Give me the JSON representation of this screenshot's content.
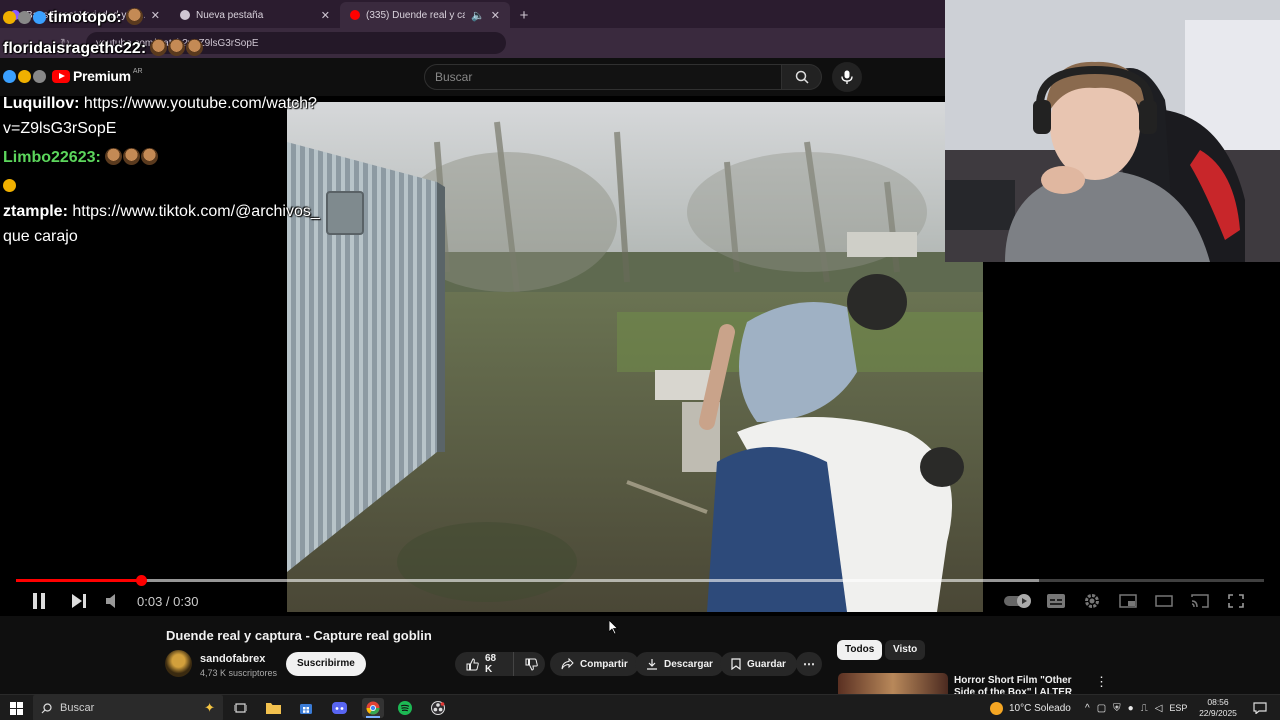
{
  "browser": {
    "tabs": [
      {
        "label": "Bass Boost Variedad y Cli...",
        "active": false
      },
      {
        "label": "Nueva pestaña",
        "active": false
      },
      {
        "label": "(335) Duende real y captura",
        "active": true
      }
    ],
    "url": "youtube.com/watch?v=Z9lsG3rSopE"
  },
  "youtube": {
    "logo_text": "Premium",
    "region": "AR",
    "search_placeholder": "Buscar"
  },
  "player": {
    "current_time": "0:03",
    "separator": " / ",
    "duration": "0:30",
    "progress_fraction": 0.1,
    "buffer_fraction": 0.82
  },
  "chat": [
    {
      "user": "timotopo:",
      "text": "",
      "user_color": "#ffffff"
    },
    {
      "user": "floridaisragethc22:",
      "text": "",
      "user_color": "#ffffff"
    },
    {
      "user": "Luquillov:",
      "text": " https://www.youtube.com/watch?",
      "user_color": "#ffffff"
    },
    {
      "user": "",
      "text": "v=Z9lsG3rSopE",
      "user_color": "#ffffff"
    },
    {
      "user": "Limbo22623:",
      "text": "",
      "user_color": "#5cd65c"
    },
    {
      "user": "ztample:",
      "text": " https://www.tiktok.com/@archivos_",
      "user_color": "#ffffff"
    },
    {
      "user": "",
      "text": "que carajo",
      "user_color": "#ffffff"
    }
  ],
  "video": {
    "title": "Duende real y captura - Capture real goblin",
    "channel": "sandofabrex",
    "subscribers": "4,73 K suscriptores",
    "subscribe_label": "Suscribirme",
    "likes": "68 K",
    "share_label": "Compartir",
    "download_label": "Descargar",
    "save_label": "Guardar"
  },
  "sidebar": {
    "chips": [
      "Todos",
      "Visto"
    ],
    "recommendation_title": "Horror Short Film \"Other Side of the Box\" | ALTER"
  },
  "taskbar": {
    "search_placeholder": "Buscar",
    "weather": "10°C  Soleado",
    "language": "ESP",
    "time": "08:56",
    "date": "22/9/2025"
  },
  "colors": {
    "accent": "#ff0000",
    "tab_bar": "#2b1c2f",
    "chat_green": "#5cd65c"
  }
}
